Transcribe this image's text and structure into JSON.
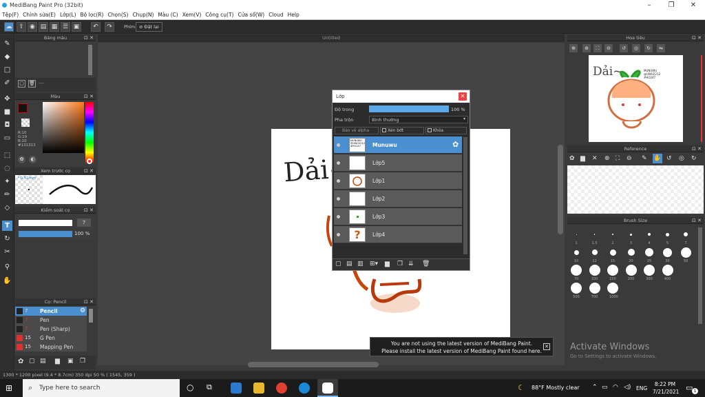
{
  "window": {
    "title": "MediBang Paint Pro (32bit)"
  },
  "menu": [
    "Tệp(F)",
    "Chỉnh sửa(E)",
    "Lớp(L)",
    "Bộ lọc(R)",
    "Chọn(S)",
    "Chụp(N)",
    "Màu (C)",
    "Xem(V)",
    "Công cụ(T)",
    "Cửa sổ(W)",
    "Cloud",
    "Help"
  ],
  "toolbar": {
    "key_label": "Phím",
    "reset_label": "Đặt lại"
  },
  "panels": {
    "palette": "Bảng màu",
    "palette_dash": "---",
    "color": "Màu",
    "color_values": {
      "r": "R:10",
      "g": "G:19",
      "b": "B:10",
      "hex": "#131313"
    },
    "brush_preview": "Xem trước cọ",
    "brush_preview_size": "* 0.51mm",
    "brush_control": "Kiểm soát cọ",
    "brush_control_size": "7",
    "brush_control_opacity": "100 %",
    "brush": "Cọ: Pencil",
    "navigator": "Hoa tiêu",
    "reference": "Reference",
    "brush_size": "Brush Size"
  },
  "brush_list": [
    {
      "size": "7",
      "name": "Pencil",
      "color": "#c00000"
    },
    {
      "size": "7",
      "name": "Pen",
      "color": "#c00000"
    },
    {
      "size": "7",
      "name": "Pen (Sharp)",
      "color": "#c00000"
    },
    {
      "size": "15",
      "name": "G Pen",
      "color": "#e03030"
    },
    {
      "size": "15",
      "name": "Mapping Pen",
      "color": "#e03030"
    }
  ],
  "document": {
    "tab": "Untitled",
    "handwriting": "Dải~"
  },
  "navigator_art": {
    "text": "Dải~",
    "label": "MUNUWU @UWU2212 #HO247"
  },
  "layer_dialog": {
    "title": "Lớp",
    "opacity_label": "Độ trong",
    "opacity_value": "100 %",
    "blend_label": "Pha trộn",
    "blend_value": "Bình thường",
    "protect_alpha": "Bảo vệ alpha",
    "clipping": "Xén bớt",
    "lock": "Khóa",
    "layers": [
      "Munuwu",
      "Lớp5",
      "Lớp1",
      "Lớp2",
      "Lớp3",
      "Lớp4"
    ],
    "first_thumb_text": "MUNUWU @UWU2212 #HO247"
  },
  "brush_sizes": [
    [
      "1",
      "1.5",
      "2",
      "3",
      "4",
      "5",
      "7"
    ],
    [
      "10",
      "12",
      "15",
      "20",
      "25",
      "30",
      "50"
    ],
    [
      "70",
      "100",
      "150",
      "200",
      "300",
      "400"
    ],
    [
      "500",
      "700",
      "1000"
    ]
  ],
  "notice": {
    "line1": "You are not using the latest version of MediBang Paint.",
    "line2": "Please install the latest version of MediBang Paint found here."
  },
  "watermark": {
    "title": "Activate Windows",
    "subtitle": "Go to Settings to activate Windows."
  },
  "status": {
    "text": "1300 * 1200 pixel   (9.4 * 8.7cm)  350 dpi   50 %   ( 1545, 359 )"
  },
  "taskbar": {
    "search_placeholder": "Type here to search",
    "weather": "88°F  Mostly clear",
    "lang": "ENG",
    "time": "8:22 PM",
    "date": "7/21/2021",
    "notif_count": "1"
  }
}
